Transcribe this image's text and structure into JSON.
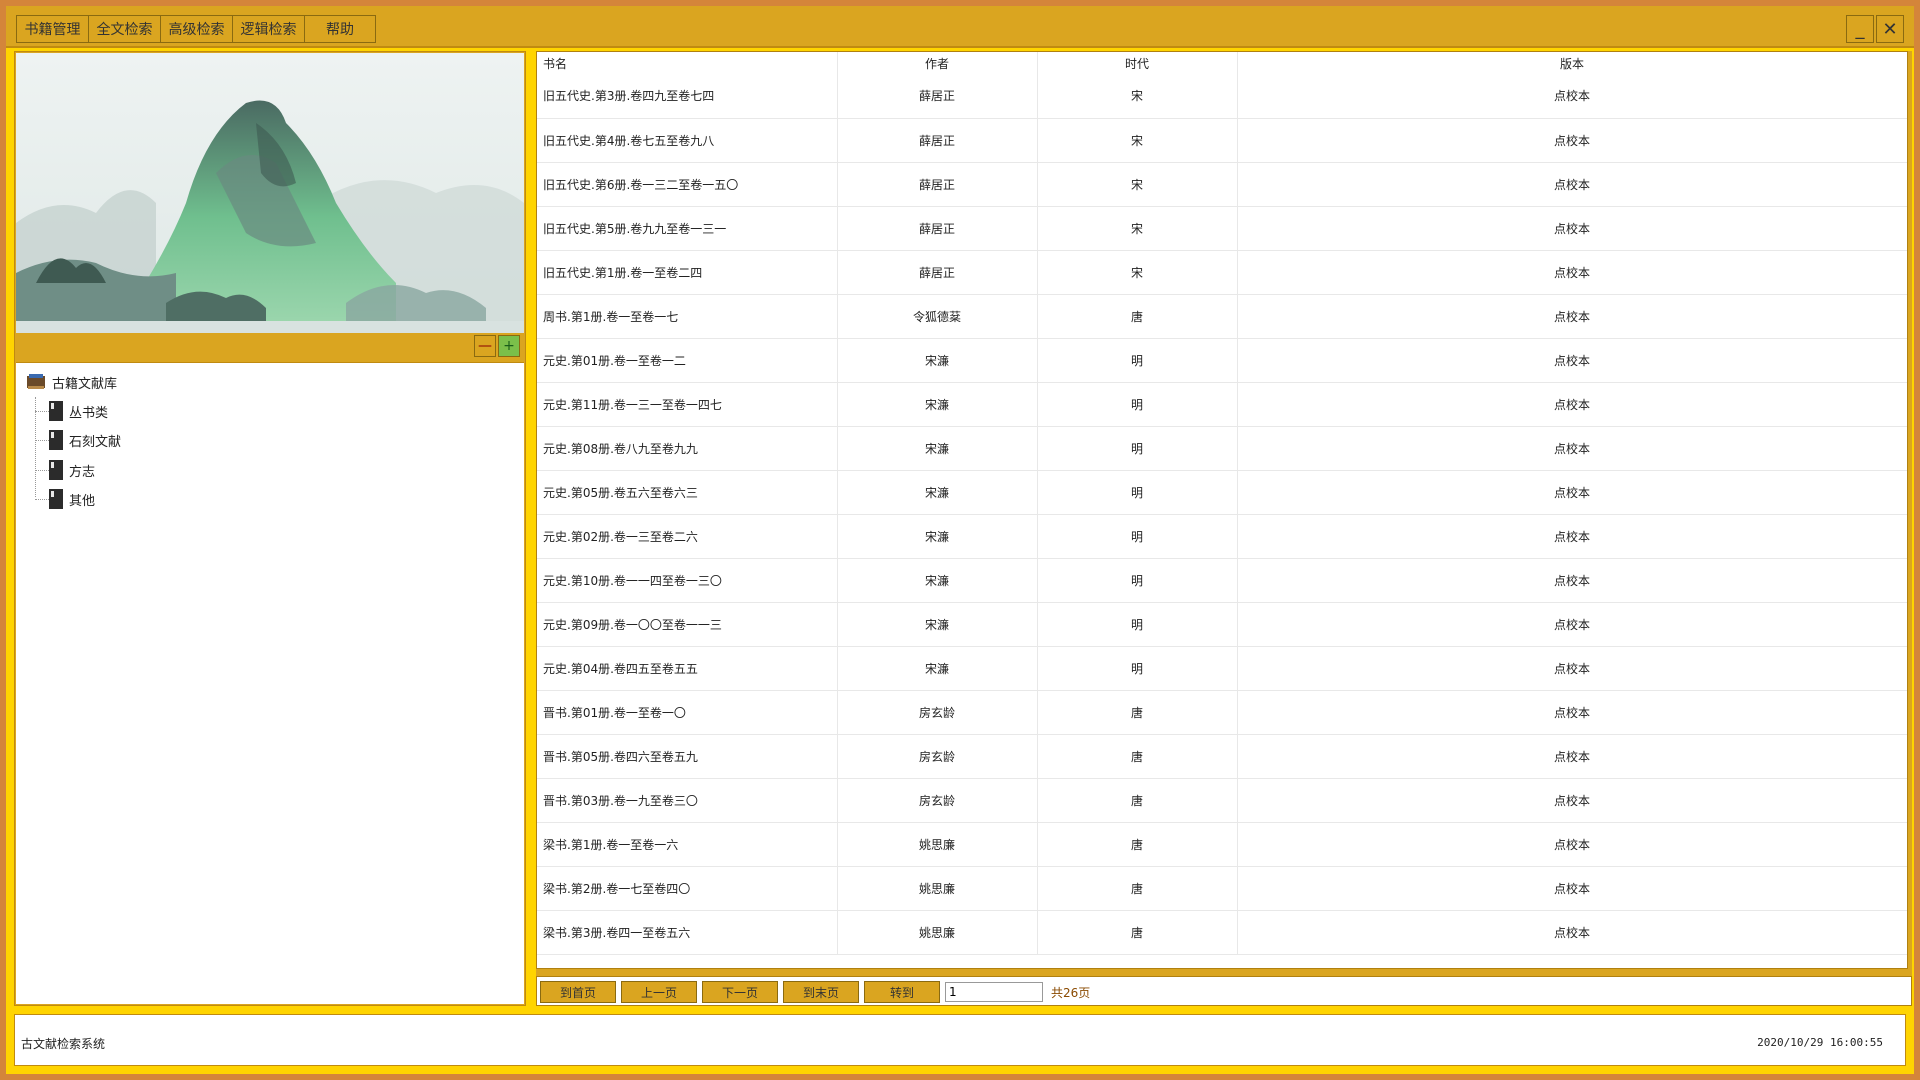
{
  "menu": {
    "items": [
      "书籍管理",
      "全文检索",
      "高级检索",
      "逻辑检索",
      "帮助"
    ]
  },
  "window": {
    "minimize": "_",
    "close": "✕"
  },
  "zoom": {
    "minus": "—",
    "plus": "+"
  },
  "tree": {
    "root": "古籍文献库",
    "children": [
      "丛书类",
      "石刻文献",
      "方志",
      "其他"
    ]
  },
  "table": {
    "headers": [
      "书名",
      "作者",
      "时代",
      "版本"
    ],
    "rows": [
      [
        "旧五代史.第3册.卷四九至卷七四",
        "薛居正",
        "宋",
        "点校本"
      ],
      [
        "旧五代史.第4册.卷七五至卷九八",
        "薛居正",
        "宋",
        "点校本"
      ],
      [
        "旧五代史.第6册.卷一三二至卷一五〇",
        "薛居正",
        "宋",
        "点校本"
      ],
      [
        "旧五代史.第5册.卷九九至卷一三一",
        "薛居正",
        "宋",
        "点校本"
      ],
      [
        "旧五代史.第1册.卷一至卷二四",
        "薛居正",
        "宋",
        "点校本"
      ],
      [
        "周书.第1册.卷一至卷一七",
        "令狐德棻",
        "唐",
        "点校本"
      ],
      [
        "元史.第01册.卷一至卷一二",
        "宋濂",
        "明",
        "点校本"
      ],
      [
        "元史.第11册.卷一三一至卷一四七",
        "宋濂",
        "明",
        "点校本"
      ],
      [
        "元史.第08册.卷八九至卷九九",
        "宋濂",
        "明",
        "点校本"
      ],
      [
        "元史.第05册.卷五六至卷六三",
        "宋濂",
        "明",
        "点校本"
      ],
      [
        "元史.第02册.卷一三至卷二六",
        "宋濂",
        "明",
        "点校本"
      ],
      [
        "元史.第10册.卷一一四至卷一三〇",
        "宋濂",
        "明",
        "点校本"
      ],
      [
        "元史.第09册.卷一〇〇至卷一一三",
        "宋濂",
        "明",
        "点校本"
      ],
      [
        "元史.第04册.卷四五至卷五五",
        "宋濂",
        "明",
        "点校本"
      ],
      [
        "晋书.第01册.卷一至卷一〇",
        "房玄龄",
        "唐",
        "点校本"
      ],
      [
        "晋书.第05册.卷四六至卷五九",
        "房玄龄",
        "唐",
        "点校本"
      ],
      [
        "晋书.第03册.卷一九至卷三〇",
        "房玄龄",
        "唐",
        "点校本"
      ],
      [
        "梁书.第1册.卷一至卷一六",
        "姚思廉",
        "唐",
        "点校本"
      ],
      [
        "梁书.第2册.卷一七至卷四〇",
        "姚思廉",
        "唐",
        "点校本"
      ],
      [
        "梁书.第3册.卷四一至卷五六",
        "姚思廉",
        "唐",
        "点校本"
      ]
    ]
  },
  "pager": {
    "first": "到首页",
    "prev": "上一页",
    "next": "下一页",
    "last": "到末页",
    "goto": "转到",
    "page_value": "1",
    "total": "共26页"
  },
  "status": {
    "app_name": "古文献检索系统",
    "datetime": "2020/10/29 16:00:55"
  },
  "colors": {
    "frame": "#ffd400",
    "bar": "#daa520",
    "outer": "#d4853a"
  }
}
